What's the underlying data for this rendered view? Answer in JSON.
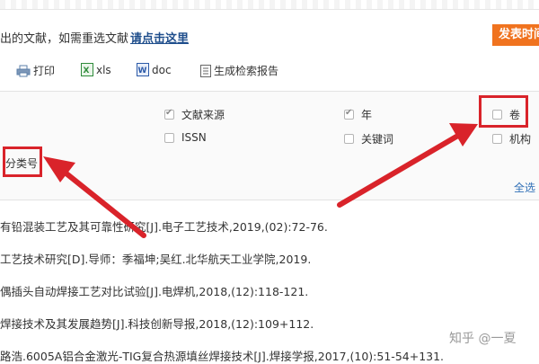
{
  "notice": {
    "text": "出的文献，如需重选文献",
    "link": "请点击这里"
  },
  "publish_button": "发表时间",
  "toolbar": {
    "print": "打印",
    "xls": "xls",
    "doc": "doc",
    "report": "生成检索报告"
  },
  "options": {
    "source": "文献来源",
    "year": "年",
    "volume": "卷",
    "issn": "ISSN",
    "keyword": "关键词",
    "org": "机构",
    "classno": "分类号"
  },
  "select_all": "全选",
  "references": [
    "有铅混装工艺及其可靠性研究[J].电子工艺技术,2019,(02):72-76.",
    "工艺技术研究[D].导师：季福坤;吴红.北华航天工业学院,2019.",
    "偶插头自动焊接工艺对比试验[J].电焊机,2018,(12):118-121.",
    "焊接技术及其发展趋势[J].科技创新导报,2018,(12):109+112.",
    "路浩.6005A铝合金激光-TIG复合热源填丝焊接技术[J].焊接学报,2017,(10):51-54+131."
  ],
  "watermark": "知乎 @一夏",
  "colors": {
    "accent": "#f0731f",
    "link": "#1f4e8c",
    "highlight": "#d9232a"
  }
}
